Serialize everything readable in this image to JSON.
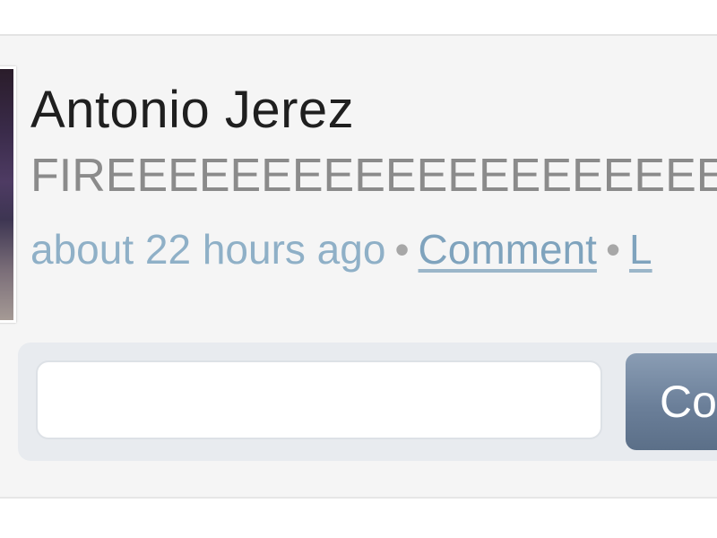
{
  "post": {
    "author": "Antonio Jerez",
    "text": "FIREEEEEEEEEEEEEEEEEEEEE",
    "timestamp": "about 22 hours ago",
    "separator": "•",
    "comment_link": "Comment",
    "like_link": "L"
  },
  "comment_form": {
    "input_value": "",
    "input_placeholder": "",
    "button_label": "Co"
  },
  "colors": {
    "post_background": "#f5f5f5",
    "meta_text": "#8fb0c7",
    "button_blue": "#6b7f99"
  }
}
